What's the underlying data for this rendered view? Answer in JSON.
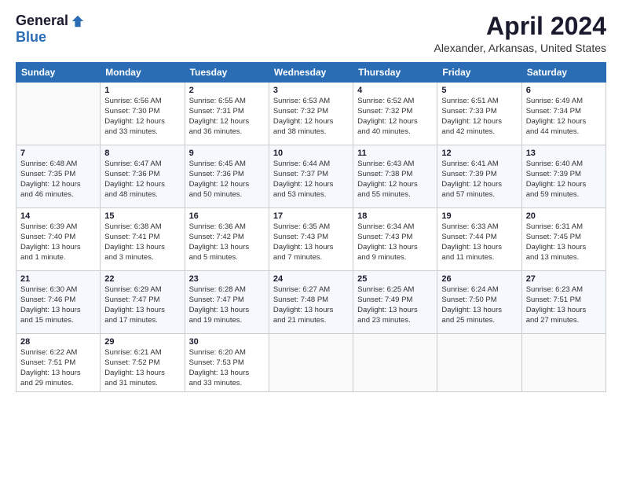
{
  "header": {
    "logo_general": "General",
    "logo_blue": "Blue",
    "month_title": "April 2024",
    "location": "Alexander, Arkansas, United States"
  },
  "weekdays": [
    "Sunday",
    "Monday",
    "Tuesday",
    "Wednesday",
    "Thursday",
    "Friday",
    "Saturday"
  ],
  "weeks": [
    [
      {
        "day": "",
        "info": ""
      },
      {
        "day": "1",
        "info": "Sunrise: 6:56 AM\nSunset: 7:30 PM\nDaylight: 12 hours\nand 33 minutes."
      },
      {
        "day": "2",
        "info": "Sunrise: 6:55 AM\nSunset: 7:31 PM\nDaylight: 12 hours\nand 36 minutes."
      },
      {
        "day": "3",
        "info": "Sunrise: 6:53 AM\nSunset: 7:32 PM\nDaylight: 12 hours\nand 38 minutes."
      },
      {
        "day": "4",
        "info": "Sunrise: 6:52 AM\nSunset: 7:32 PM\nDaylight: 12 hours\nand 40 minutes."
      },
      {
        "day": "5",
        "info": "Sunrise: 6:51 AM\nSunset: 7:33 PM\nDaylight: 12 hours\nand 42 minutes."
      },
      {
        "day": "6",
        "info": "Sunrise: 6:49 AM\nSunset: 7:34 PM\nDaylight: 12 hours\nand 44 minutes."
      }
    ],
    [
      {
        "day": "7",
        "info": "Sunrise: 6:48 AM\nSunset: 7:35 PM\nDaylight: 12 hours\nand 46 minutes."
      },
      {
        "day": "8",
        "info": "Sunrise: 6:47 AM\nSunset: 7:36 PM\nDaylight: 12 hours\nand 48 minutes."
      },
      {
        "day": "9",
        "info": "Sunrise: 6:45 AM\nSunset: 7:36 PM\nDaylight: 12 hours\nand 50 minutes."
      },
      {
        "day": "10",
        "info": "Sunrise: 6:44 AM\nSunset: 7:37 PM\nDaylight: 12 hours\nand 53 minutes."
      },
      {
        "day": "11",
        "info": "Sunrise: 6:43 AM\nSunset: 7:38 PM\nDaylight: 12 hours\nand 55 minutes."
      },
      {
        "day": "12",
        "info": "Sunrise: 6:41 AM\nSunset: 7:39 PM\nDaylight: 12 hours\nand 57 minutes."
      },
      {
        "day": "13",
        "info": "Sunrise: 6:40 AM\nSunset: 7:39 PM\nDaylight: 12 hours\nand 59 minutes."
      }
    ],
    [
      {
        "day": "14",
        "info": "Sunrise: 6:39 AM\nSunset: 7:40 PM\nDaylight: 13 hours\nand 1 minute."
      },
      {
        "day": "15",
        "info": "Sunrise: 6:38 AM\nSunset: 7:41 PM\nDaylight: 13 hours\nand 3 minutes."
      },
      {
        "day": "16",
        "info": "Sunrise: 6:36 AM\nSunset: 7:42 PM\nDaylight: 13 hours\nand 5 minutes."
      },
      {
        "day": "17",
        "info": "Sunrise: 6:35 AM\nSunset: 7:43 PM\nDaylight: 13 hours\nand 7 minutes."
      },
      {
        "day": "18",
        "info": "Sunrise: 6:34 AM\nSunset: 7:43 PM\nDaylight: 13 hours\nand 9 minutes."
      },
      {
        "day": "19",
        "info": "Sunrise: 6:33 AM\nSunset: 7:44 PM\nDaylight: 13 hours\nand 11 minutes."
      },
      {
        "day": "20",
        "info": "Sunrise: 6:31 AM\nSunset: 7:45 PM\nDaylight: 13 hours\nand 13 minutes."
      }
    ],
    [
      {
        "day": "21",
        "info": "Sunrise: 6:30 AM\nSunset: 7:46 PM\nDaylight: 13 hours\nand 15 minutes."
      },
      {
        "day": "22",
        "info": "Sunrise: 6:29 AM\nSunset: 7:47 PM\nDaylight: 13 hours\nand 17 minutes."
      },
      {
        "day": "23",
        "info": "Sunrise: 6:28 AM\nSunset: 7:47 PM\nDaylight: 13 hours\nand 19 minutes."
      },
      {
        "day": "24",
        "info": "Sunrise: 6:27 AM\nSunset: 7:48 PM\nDaylight: 13 hours\nand 21 minutes."
      },
      {
        "day": "25",
        "info": "Sunrise: 6:25 AM\nSunset: 7:49 PM\nDaylight: 13 hours\nand 23 minutes."
      },
      {
        "day": "26",
        "info": "Sunrise: 6:24 AM\nSunset: 7:50 PM\nDaylight: 13 hours\nand 25 minutes."
      },
      {
        "day": "27",
        "info": "Sunrise: 6:23 AM\nSunset: 7:51 PM\nDaylight: 13 hours\nand 27 minutes."
      }
    ],
    [
      {
        "day": "28",
        "info": "Sunrise: 6:22 AM\nSunset: 7:51 PM\nDaylight: 13 hours\nand 29 minutes."
      },
      {
        "day": "29",
        "info": "Sunrise: 6:21 AM\nSunset: 7:52 PM\nDaylight: 13 hours\nand 31 minutes."
      },
      {
        "day": "30",
        "info": "Sunrise: 6:20 AM\nSunset: 7:53 PM\nDaylight: 13 hours\nand 33 minutes."
      },
      {
        "day": "",
        "info": ""
      },
      {
        "day": "",
        "info": ""
      },
      {
        "day": "",
        "info": ""
      },
      {
        "day": "",
        "info": ""
      }
    ]
  ]
}
